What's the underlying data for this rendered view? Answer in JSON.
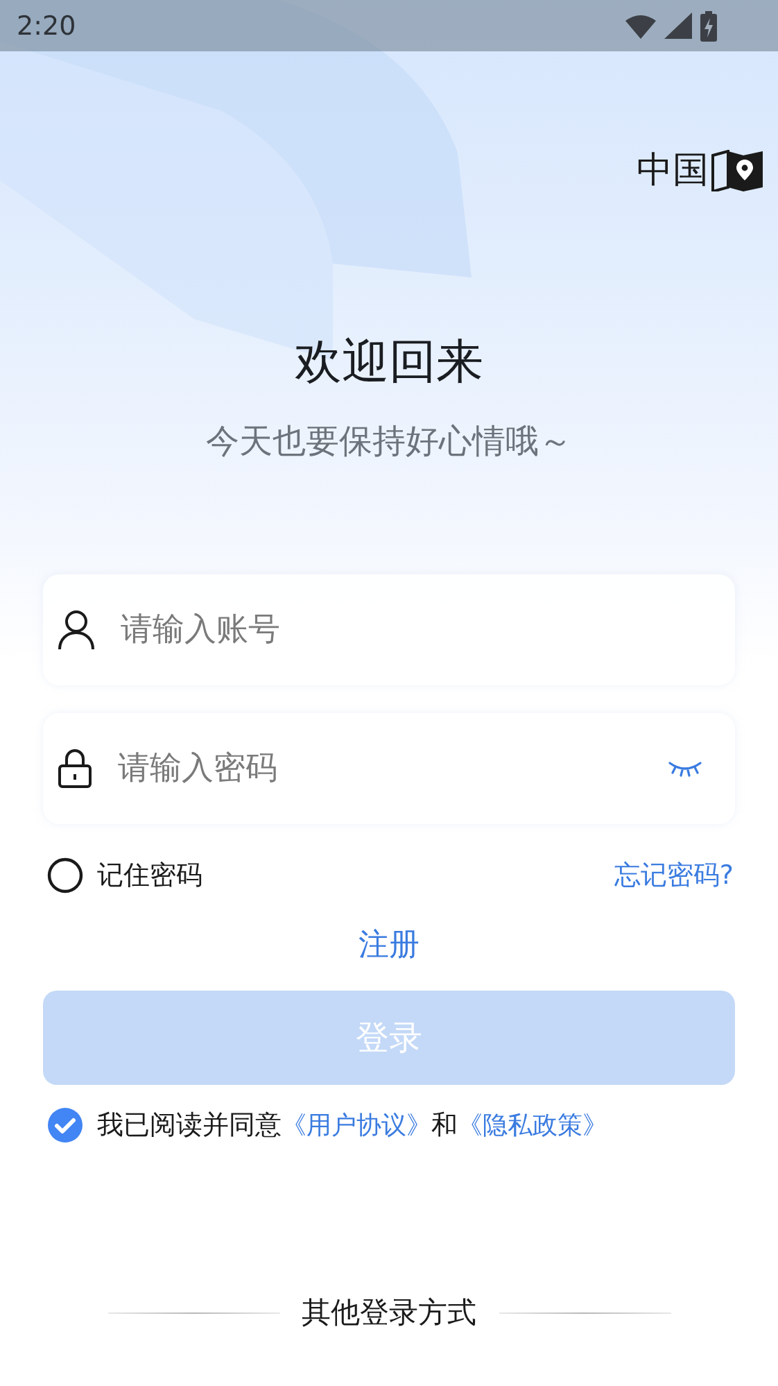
{
  "status_bar": {
    "time": "2:20"
  },
  "region": {
    "label": "中国"
  },
  "welcome": {
    "title": "欢迎回来",
    "subtitle": "今天也要保持好心情哦～"
  },
  "fields": [
    {
      "kind": "account",
      "placeholder": "请输入账号"
    },
    {
      "kind": "password",
      "placeholder": "请输入密码"
    }
  ],
  "remember": {
    "label": "记住密码",
    "checked": false
  },
  "forgot_password": "忘记密码?",
  "register": "注册",
  "login_button": {
    "label": "登录",
    "disabled": true
  },
  "agreement": {
    "checked": true,
    "text_before": "我已阅读并同意",
    "link_1": "《用户协议》",
    "text_between": "和",
    "link_2": "《隐私政策》"
  },
  "other_login": {
    "label": "其他登录方式"
  }
}
